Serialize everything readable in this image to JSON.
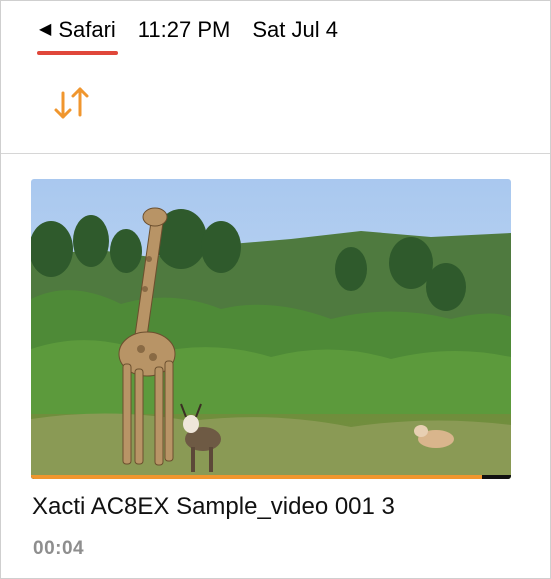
{
  "status_bar": {
    "back_label": "Safari",
    "time": "11:27 PM",
    "date": "Sat Jul 4"
  },
  "toolbar": {
    "sort_icon": "sort-arrows-icon",
    "accent_color": "#f0962e"
  },
  "video": {
    "title": "Xacti AC8EX Sample_video 001 3",
    "duration": "00:04",
    "progress": 0.94,
    "thumbnail_icon": "video-thumbnail"
  },
  "colors": {
    "back_underline": "#e0473a",
    "progress": "#f0962e",
    "duration_text": "#8e8e8e"
  }
}
